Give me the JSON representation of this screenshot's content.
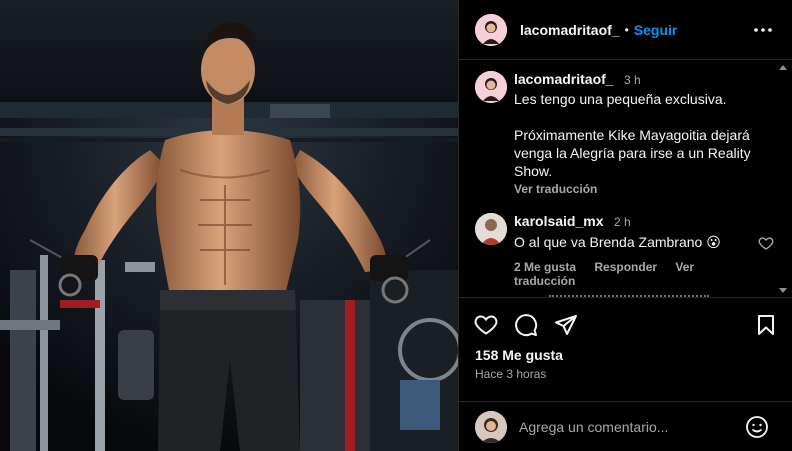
{
  "post": {
    "username": "lacomadritaof_",
    "separator": "•",
    "follow_label": "Seguir",
    "more_icon": "more-horizontal-icon"
  },
  "caption": {
    "username": "lacomadritaof_",
    "time": "3 h",
    "line1": "Les tengo una pequeña exclusiva.",
    "line2": "Próximamente Kike Mayagoitia dejará venga la Alegría para irse a un Reality Show.",
    "translate": "Ver traducción"
  },
  "comments": [
    {
      "username": "karolsaid_mx",
      "time": "2 h",
      "text": "O al que va Brenda Zambrano 😮",
      "likes": "2 Me gusta",
      "reply": "Responder",
      "translate": "Ver traducción"
    }
  ],
  "actions": {
    "likes": "158 Me gusta",
    "ago": "Hace 3 horas",
    "icons": [
      "heart-icon",
      "comment-icon",
      "share-icon",
      "save-icon"
    ]
  },
  "add_comment": {
    "placeholder": "Agrega un comentario...",
    "emoji_icon": "emoji-icon"
  },
  "colors": {
    "background": "#000000",
    "accent": "#0095f6",
    "muted": "#a8a8a8",
    "divider": "#262626"
  }
}
